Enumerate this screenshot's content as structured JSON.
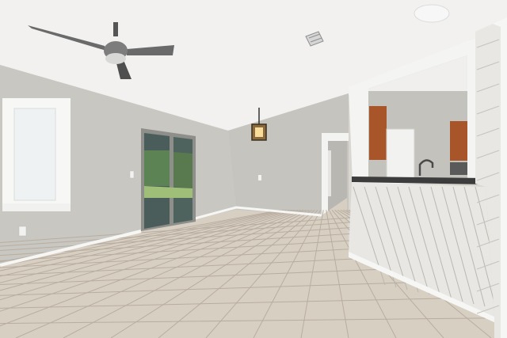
{
  "scene": {
    "description_hidden": "",
    "colors": {
      "ceiling": "#f2f1ef",
      "wall_left": "#c9c7c2",
      "wall_back": "#c6c4bf",
      "floor": "#d8cfc3",
      "grout": "#b8ad9f",
      "trim": "#f6f6f4",
      "cabinet": "#a8552a",
      "paneling": "#e9e7e3",
      "counter": "#3c3c3c",
      "window_glass": "#eef2f3",
      "slider_glass": "#4a5d5a",
      "fan_blade": "#6a6a6a"
    },
    "icons": [
      "ceiling-fan-icon",
      "pendant-light-icon",
      "air-vent-icon",
      "smoke-detector-icon",
      "faucet-icon"
    ]
  }
}
